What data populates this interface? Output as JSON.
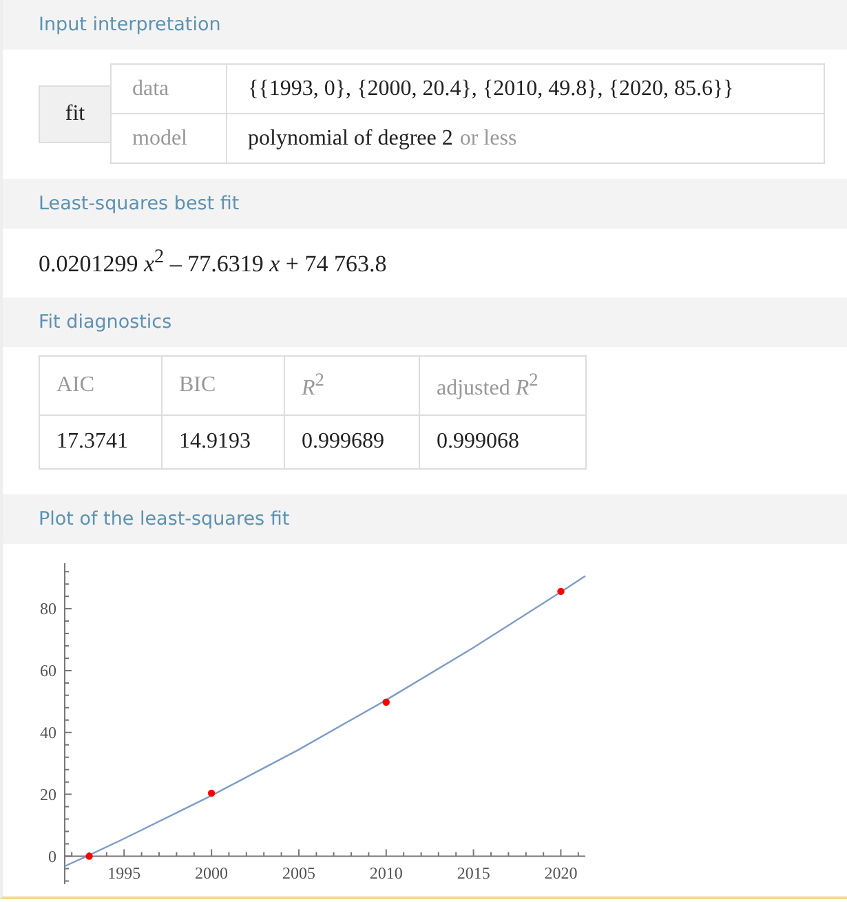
{
  "sections": [
    {
      "kind": "input",
      "title": "Input interpretation",
      "function": "fit",
      "rows": [
        {
          "label": "data",
          "value": "{{1993, 0}, {2000, 20.4}, {2010, 49.8}, {2020, 85.6}}"
        },
        {
          "label": "model",
          "value": "polynomial of degree 2",
          "note": "or less"
        }
      ]
    },
    {
      "kind": "formula",
      "title": "Least-squares best fit",
      "formula": "0.0201299 *x*$^{2}$ – 77.6319 *x* + 74 763.8"
    },
    {
      "kind": "table",
      "title": "Fit diagnostics",
      "columns": [
        "AIC",
        "BIC",
        "*R*$^{2}$",
        "adjusted *R*$^{2}$"
      ],
      "values": [
        "17.3741",
        "14.9193",
        "0.999689",
        "0.999068"
      ]
    },
    {
      "kind": "chart",
      "title": "Plot of the least-squares fit",
      "chart_data": {
        "type": "line",
        "x": [
          1991.6,
          1993,
          1995,
          2000,
          2005,
          2010,
          2015,
          2020,
          2021.4
        ],
        "xlim": [
          1991.6,
          2021.4
        ],
        "ylim": [
          -9,
          94.7
        ],
        "xticks": [
          1995,
          2000,
          2005,
          2010,
          2015,
          2020
        ],
        "yticks": [
          0,
          20,
          40,
          60,
          80
        ],
        "series": [
          {
            "color": "#7e9cc8",
            "values": [
              -3.2,
              0.4,
              5.7,
              19.6,
              34.5,
              50.5,
              67.4,
              85.4,
              90.6
            ]
          },
          {
            "type": "scatter",
            "color": "#ff0000",
            "values": [
              null,
              0,
              null,
              20.4,
              null,
              49.8,
              null,
              85.6,
              null
            ]
          }
        ]
      }
    }
  ]
}
